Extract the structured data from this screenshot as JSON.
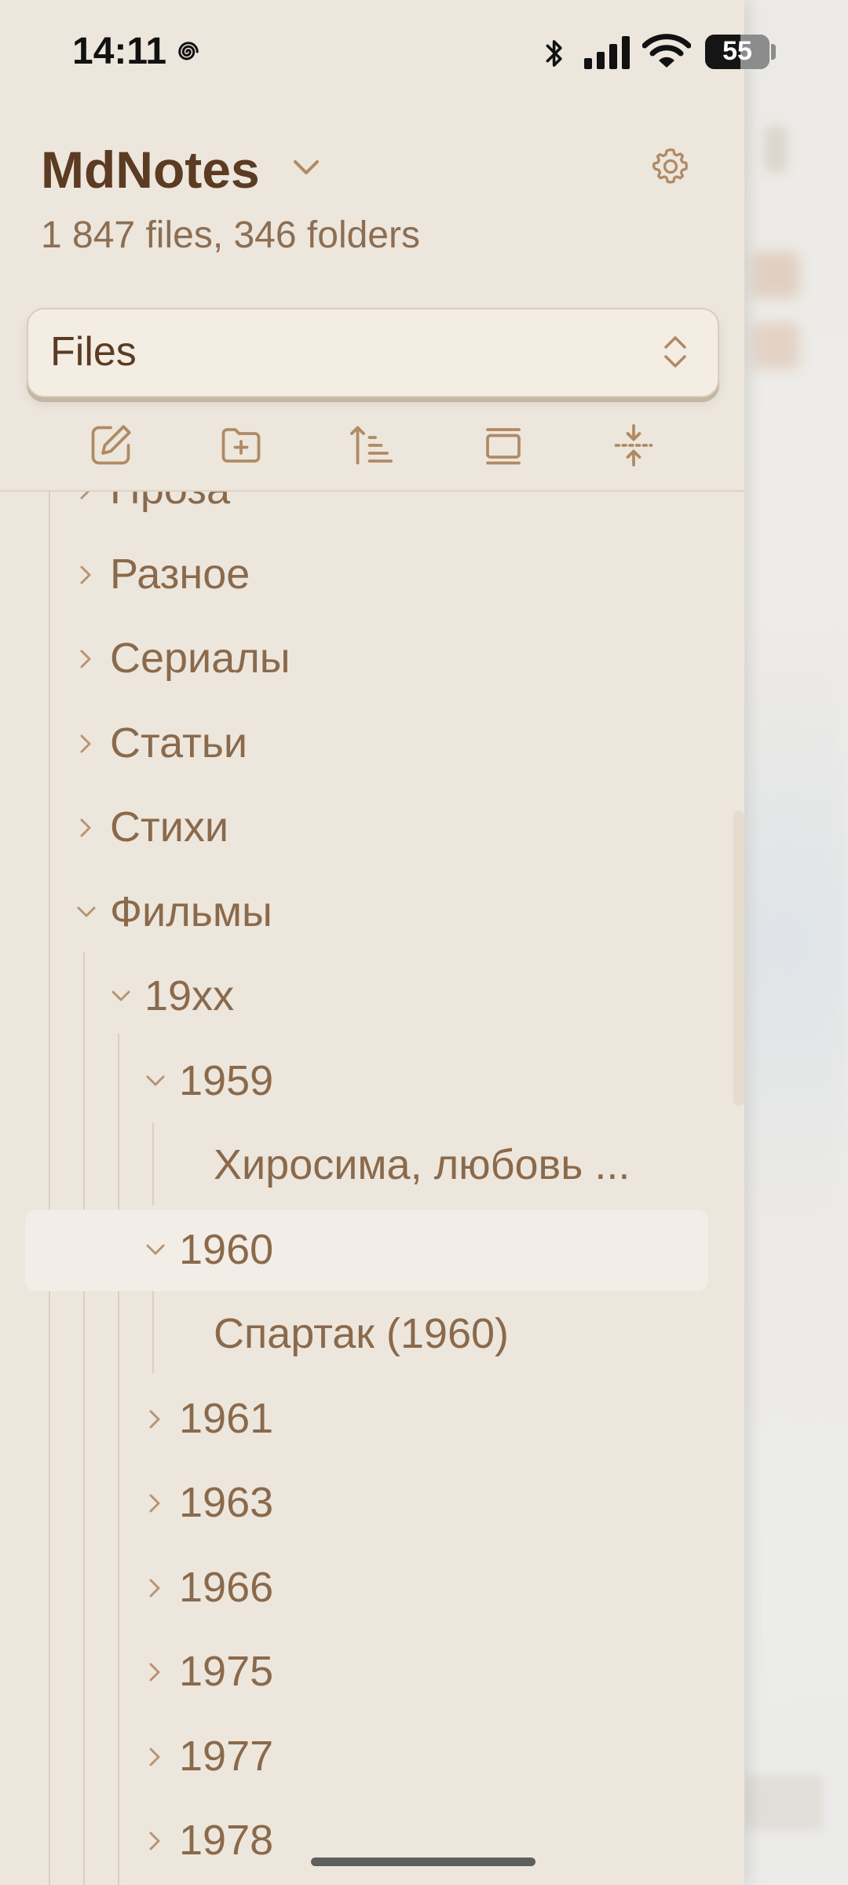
{
  "status_bar": {
    "time": "14:11",
    "battery_level": "55",
    "battery_fraction": 0.55
  },
  "header": {
    "vault_name": "MdNotes",
    "stats": "1 847 files, 346 folders"
  },
  "view_selector": {
    "selected": "Files"
  },
  "toolbar": {
    "buttons": [
      "new-note",
      "new-folder",
      "sort",
      "toggle-view",
      "collapse-all"
    ]
  },
  "tree": {
    "items": [
      {
        "label": "Проза",
        "type": "folder",
        "expanded": false,
        "depth": 1
      },
      {
        "label": "Разное",
        "type": "folder",
        "expanded": false,
        "depth": 1
      },
      {
        "label": "Сериалы",
        "type": "folder",
        "expanded": false,
        "depth": 1
      },
      {
        "label": "Статьи",
        "type": "folder",
        "expanded": false,
        "depth": 1
      },
      {
        "label": "Стихи",
        "type": "folder",
        "expanded": false,
        "depth": 1
      },
      {
        "label": "Фильмы",
        "type": "folder",
        "expanded": true,
        "depth": 1
      },
      {
        "label": "19xx",
        "type": "folder",
        "expanded": true,
        "depth": 2
      },
      {
        "label": "1959",
        "type": "folder",
        "expanded": true,
        "depth": 3
      },
      {
        "label": "Хиросима, любовь ...",
        "type": "file",
        "depth": 4
      },
      {
        "label": "1960",
        "type": "folder",
        "expanded": true,
        "depth": 3,
        "active": true
      },
      {
        "label": "Спартак (1960)",
        "type": "file",
        "depth": 4
      },
      {
        "label": "1961",
        "type": "folder",
        "expanded": false,
        "depth": 3
      },
      {
        "label": "1963",
        "type": "folder",
        "expanded": false,
        "depth": 3
      },
      {
        "label": "1966",
        "type": "folder",
        "expanded": false,
        "depth": 3
      },
      {
        "label": "1975",
        "type": "folder",
        "expanded": false,
        "depth": 3
      },
      {
        "label": "1977",
        "type": "folder",
        "expanded": false,
        "depth": 3
      },
      {
        "label": "1978",
        "type": "folder",
        "expanded": false,
        "depth": 3
      }
    ]
  },
  "colors": {
    "drawer_bg": "#ede6dc",
    "title": "#5b3b22",
    "tree_text": "#8a6a4c",
    "icon": "#b08a64"
  }
}
